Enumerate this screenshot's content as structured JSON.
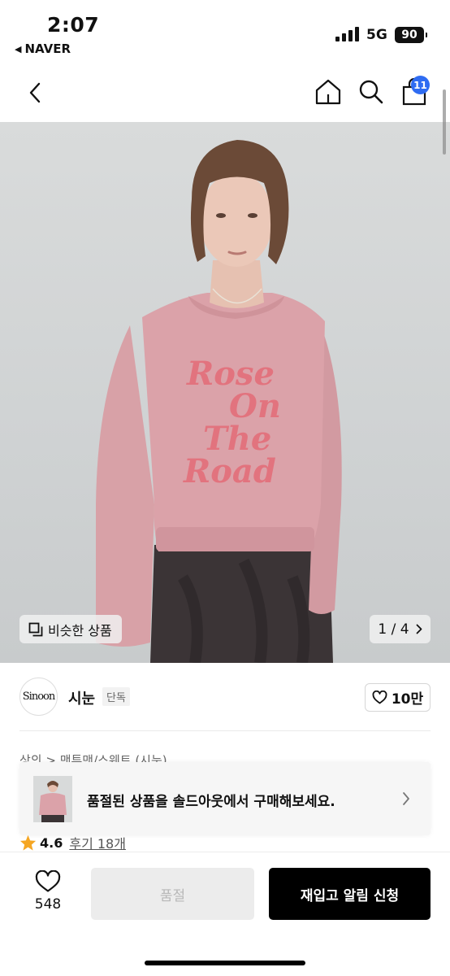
{
  "status": {
    "time": "2:07",
    "back_app": "NAVER",
    "network": "5G",
    "battery": "90"
  },
  "nav": {
    "cart_count": "11",
    "icons": [
      "back-icon",
      "home-icon",
      "search-icon",
      "cart-icon"
    ]
  },
  "hero": {
    "shirt_text": [
      "Rose",
      "On",
      "The",
      "Road"
    ],
    "similar_label": "비슷한 상품",
    "pager": "1 / 4"
  },
  "brand": {
    "logo_text": "Sinoon",
    "name": "시눈",
    "tag": "단독",
    "likes": "10만"
  },
  "breadcrumb": "상의 > 맨투맨/스웨트 (시눈)",
  "banner": {
    "text": "품절된 상품을 솔드아웃에서 구매해보세요."
  },
  "rating": {
    "score": "4.6",
    "reviews": "후기 18개"
  },
  "bottom": {
    "wish_count": "548",
    "soldout_label": "품절",
    "restock_label": "재입고 알림 신청"
  },
  "colors": {
    "accent": "#2f6cf2",
    "star": "#f5a623",
    "sweatshirt": "#d9a0a6",
    "print": "#e2737e"
  }
}
